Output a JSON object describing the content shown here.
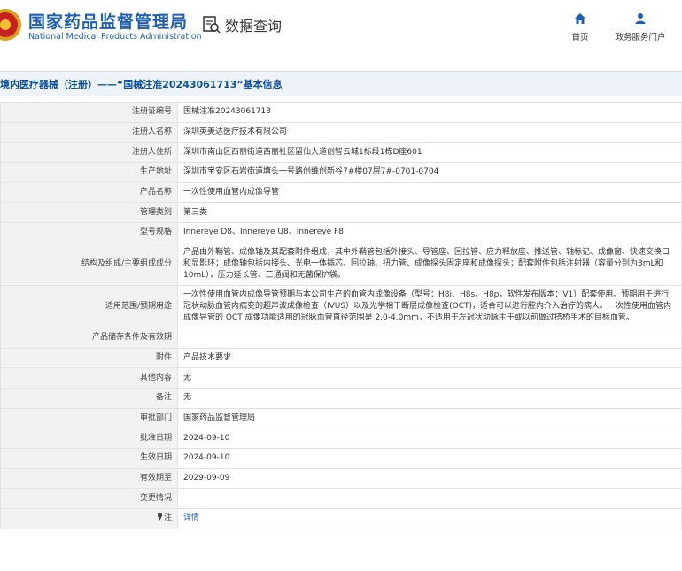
{
  "header": {
    "title_cn": "国家药品监督管理局",
    "title_en": "National Medical Products Administration",
    "search_label": "数据查询",
    "nav": [
      {
        "label": "首页",
        "icon": "home-icon"
      },
      {
        "label": "政务服务门户",
        "icon": "user-icon"
      }
    ]
  },
  "page_title": "境内医疗器械（注册）——“国械注准20243061713”基本信息",
  "fields": [
    {
      "label": "注册证编号",
      "value": "国械注准20243061713"
    },
    {
      "label": "注册人名称",
      "value": "深圳英美达医疗技术有限公司"
    },
    {
      "label": "注册人住所",
      "value": "深圳市南山区西丽街道西丽社区留仙大道创智云城1标段1栋D座601"
    },
    {
      "label": "生产地址",
      "value": "深圳市宝安区石岩街道塘头一号路创维创新谷7#楼07层7#-0701-0704"
    },
    {
      "label": "产品名称",
      "value": "一次性使用血管内成像导管"
    },
    {
      "label": "管理类别",
      "value": "第三类"
    },
    {
      "label": "型号规格",
      "value": "Innereye D8、Innereye U8、Innereye F8"
    },
    {
      "label": "结构及组成/主要组成成分",
      "value": "产品由外鞘管、成像轴及其配套附件组成，其中外鞘管包括外接头、导管座、回拉管、应力释放座、推送管、轴标记、成像窗、快速交换口和显影环；成像轴包括内接头、光电一体插芯、回拉轴、扭力管、成像探头固定座和成像探头；配套附件包括注射器（容量分别为3mL和10mL），压力延长管、三通阀和无菌保护袋。"
    },
    {
      "label": "适用范围/预期用途",
      "value": "一次性使用血管内成像导管预期与本公司生产的血管内成像设备（型号：H8i、H8s、H8p，软件发布版本：V1）配套使用。预期用于进行冠状动脉血管内病变的超声波成像检查（IVUS）以及光学相干断层成像检查(OCT)，适合可以进行腔内介入治疗的病人。一次性使用血管内成像导管的 OCT 成像功能适用的冠脉血管直径范围是 2.0-4.0mm，不适用于左冠状动脉主干或以前做过搭桥手术的目标血管。"
    },
    {
      "label": "产品储存条件及有效期",
      "value": ""
    },
    {
      "label": "附件",
      "value": "产品技术要求"
    },
    {
      "label": "其他内容",
      "value": "无"
    },
    {
      "label": "备注",
      "value": "无"
    },
    {
      "label": "审批部门",
      "value": "国家药品监督管理局"
    },
    {
      "label": "批准日期",
      "value": "2024-09-10"
    },
    {
      "label": "生效日期",
      "value": "2024-09-10"
    },
    {
      "label": "有效期至",
      "value": "2029-09-09"
    },
    {
      "label": "变更情况",
      "value": ""
    },
    {
      "label": "注",
      "value": "详情",
      "link": true
    }
  ],
  "colors": {
    "brand": "#1d5fb4",
    "title_bg": "#eef3fa",
    "label_bg": "#f2f2f2"
  }
}
